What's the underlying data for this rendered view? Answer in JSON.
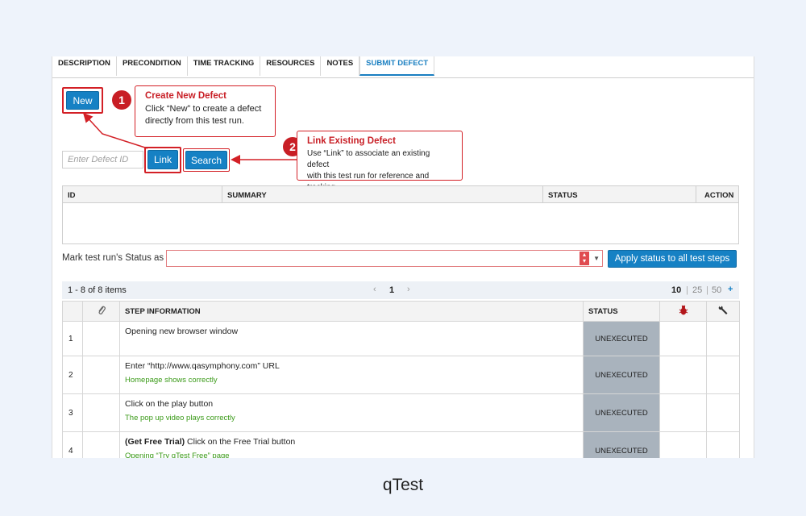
{
  "tabs": [
    "DESCRIPTION",
    "PRECONDITION",
    "TIME TRACKING",
    "RESOURCES",
    "NOTES",
    "SUBMIT DEFECT"
  ],
  "active_tab": "SUBMIT DEFECT",
  "buttons": {
    "new": "New",
    "link": "Link",
    "search": "Search",
    "apply": "Apply status to all test steps"
  },
  "callouts": {
    "one": {
      "num": "1",
      "title": "Create New Defect",
      "line1": "Click “New” to create a defect",
      "line2": "directly from this test run."
    },
    "two": {
      "num": "2",
      "title": "Link Existing Defect",
      "line1": "Use “Link” to associate an existing defect",
      "line2": "with this test run for reference and tracking."
    }
  },
  "defect_input": {
    "placeholder": "Enter Defect ID"
  },
  "defect_table": {
    "headers": [
      "ID",
      "SUMMARY",
      "STATUS",
      "ACTION"
    ]
  },
  "status_row": {
    "label": "Mark test run's Status as"
  },
  "pager": {
    "range": "1 - 8 of 8 items",
    "prev": "‹",
    "page": "1",
    "next": "›",
    "sizes": [
      "10",
      "25",
      "50"
    ],
    "sep": "|",
    "plus": "+"
  },
  "steps_table": {
    "headers": {
      "info": "STEP INFORMATION",
      "status": "STATUS"
    },
    "rows": [
      {
        "num": "1",
        "step": "Opening new browser window",
        "expected": "",
        "status": "UNEXECUTED"
      },
      {
        "num": "2",
        "step": "Enter “http://www.qasymphony.com” URL",
        "expected": "Homepage shows correctly",
        "status": "UNEXECUTED"
      },
      {
        "num": "3",
        "step": "Click on the play button",
        "expected": "The pop up video plays correctly",
        "status": "UNEXECUTED"
      },
      {
        "num": "4",
        "step_bold": "(Get Free Trial)",
        "step": " Click on the Free Trial button",
        "expected": "Opening “Try qTest Free” page",
        "status": "UNEXECUTED"
      }
    ]
  },
  "caption": "qTest",
  "colors": {
    "primary": "#1681c4",
    "annotation": "#d32026",
    "status_cell": "#a9b3bd",
    "expected_text": "#3a9a18"
  },
  "icons": [
    "paperclip-icon",
    "bug-icon",
    "wrench-icon"
  ]
}
